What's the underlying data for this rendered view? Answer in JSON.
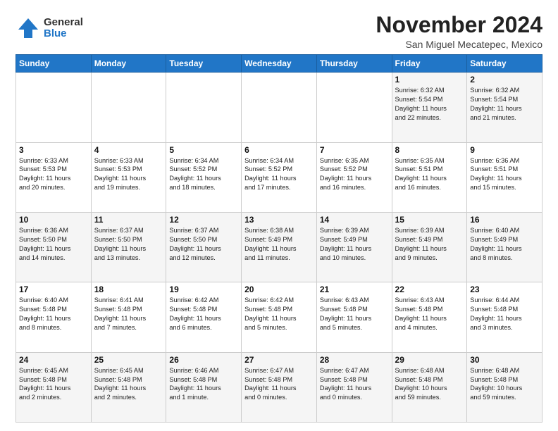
{
  "logo": {
    "general": "General",
    "blue": "Blue"
  },
  "title": "November 2024",
  "location": "San Miguel Mecatepec, Mexico",
  "days_header": [
    "Sunday",
    "Monday",
    "Tuesday",
    "Wednesday",
    "Thursday",
    "Friday",
    "Saturday"
  ],
  "weeks": [
    [
      {
        "day": "",
        "info": ""
      },
      {
        "day": "",
        "info": ""
      },
      {
        "day": "",
        "info": ""
      },
      {
        "day": "",
        "info": ""
      },
      {
        "day": "",
        "info": ""
      },
      {
        "day": "1",
        "info": "Sunrise: 6:32 AM\nSunset: 5:54 PM\nDaylight: 11 hours\nand 22 minutes."
      },
      {
        "day": "2",
        "info": "Sunrise: 6:32 AM\nSunset: 5:54 PM\nDaylight: 11 hours\nand 21 minutes."
      }
    ],
    [
      {
        "day": "3",
        "info": "Sunrise: 6:33 AM\nSunset: 5:53 PM\nDaylight: 11 hours\nand 20 minutes."
      },
      {
        "day": "4",
        "info": "Sunrise: 6:33 AM\nSunset: 5:53 PM\nDaylight: 11 hours\nand 19 minutes."
      },
      {
        "day": "5",
        "info": "Sunrise: 6:34 AM\nSunset: 5:52 PM\nDaylight: 11 hours\nand 18 minutes."
      },
      {
        "day": "6",
        "info": "Sunrise: 6:34 AM\nSunset: 5:52 PM\nDaylight: 11 hours\nand 17 minutes."
      },
      {
        "day": "7",
        "info": "Sunrise: 6:35 AM\nSunset: 5:52 PM\nDaylight: 11 hours\nand 16 minutes."
      },
      {
        "day": "8",
        "info": "Sunrise: 6:35 AM\nSunset: 5:51 PM\nDaylight: 11 hours\nand 16 minutes."
      },
      {
        "day": "9",
        "info": "Sunrise: 6:36 AM\nSunset: 5:51 PM\nDaylight: 11 hours\nand 15 minutes."
      }
    ],
    [
      {
        "day": "10",
        "info": "Sunrise: 6:36 AM\nSunset: 5:50 PM\nDaylight: 11 hours\nand 14 minutes."
      },
      {
        "day": "11",
        "info": "Sunrise: 6:37 AM\nSunset: 5:50 PM\nDaylight: 11 hours\nand 13 minutes."
      },
      {
        "day": "12",
        "info": "Sunrise: 6:37 AM\nSunset: 5:50 PM\nDaylight: 11 hours\nand 12 minutes."
      },
      {
        "day": "13",
        "info": "Sunrise: 6:38 AM\nSunset: 5:49 PM\nDaylight: 11 hours\nand 11 minutes."
      },
      {
        "day": "14",
        "info": "Sunrise: 6:39 AM\nSunset: 5:49 PM\nDaylight: 11 hours\nand 10 minutes."
      },
      {
        "day": "15",
        "info": "Sunrise: 6:39 AM\nSunset: 5:49 PM\nDaylight: 11 hours\nand 9 minutes."
      },
      {
        "day": "16",
        "info": "Sunrise: 6:40 AM\nSunset: 5:49 PM\nDaylight: 11 hours\nand 8 minutes."
      }
    ],
    [
      {
        "day": "17",
        "info": "Sunrise: 6:40 AM\nSunset: 5:48 PM\nDaylight: 11 hours\nand 8 minutes."
      },
      {
        "day": "18",
        "info": "Sunrise: 6:41 AM\nSunset: 5:48 PM\nDaylight: 11 hours\nand 7 minutes."
      },
      {
        "day": "19",
        "info": "Sunrise: 6:42 AM\nSunset: 5:48 PM\nDaylight: 11 hours\nand 6 minutes."
      },
      {
        "day": "20",
        "info": "Sunrise: 6:42 AM\nSunset: 5:48 PM\nDaylight: 11 hours\nand 5 minutes."
      },
      {
        "day": "21",
        "info": "Sunrise: 6:43 AM\nSunset: 5:48 PM\nDaylight: 11 hours\nand 5 minutes."
      },
      {
        "day": "22",
        "info": "Sunrise: 6:43 AM\nSunset: 5:48 PM\nDaylight: 11 hours\nand 4 minutes."
      },
      {
        "day": "23",
        "info": "Sunrise: 6:44 AM\nSunset: 5:48 PM\nDaylight: 11 hours\nand 3 minutes."
      }
    ],
    [
      {
        "day": "24",
        "info": "Sunrise: 6:45 AM\nSunset: 5:48 PM\nDaylight: 11 hours\nand 2 minutes."
      },
      {
        "day": "25",
        "info": "Sunrise: 6:45 AM\nSunset: 5:48 PM\nDaylight: 11 hours\nand 2 minutes."
      },
      {
        "day": "26",
        "info": "Sunrise: 6:46 AM\nSunset: 5:48 PM\nDaylight: 11 hours\nand 1 minute."
      },
      {
        "day": "27",
        "info": "Sunrise: 6:47 AM\nSunset: 5:48 PM\nDaylight: 11 hours\nand 0 minutes."
      },
      {
        "day": "28",
        "info": "Sunrise: 6:47 AM\nSunset: 5:48 PM\nDaylight: 11 hours\nand 0 minutes."
      },
      {
        "day": "29",
        "info": "Sunrise: 6:48 AM\nSunset: 5:48 PM\nDaylight: 10 hours\nand 59 minutes."
      },
      {
        "day": "30",
        "info": "Sunrise: 6:48 AM\nSunset: 5:48 PM\nDaylight: 10 hours\nand 59 minutes."
      }
    ]
  ]
}
